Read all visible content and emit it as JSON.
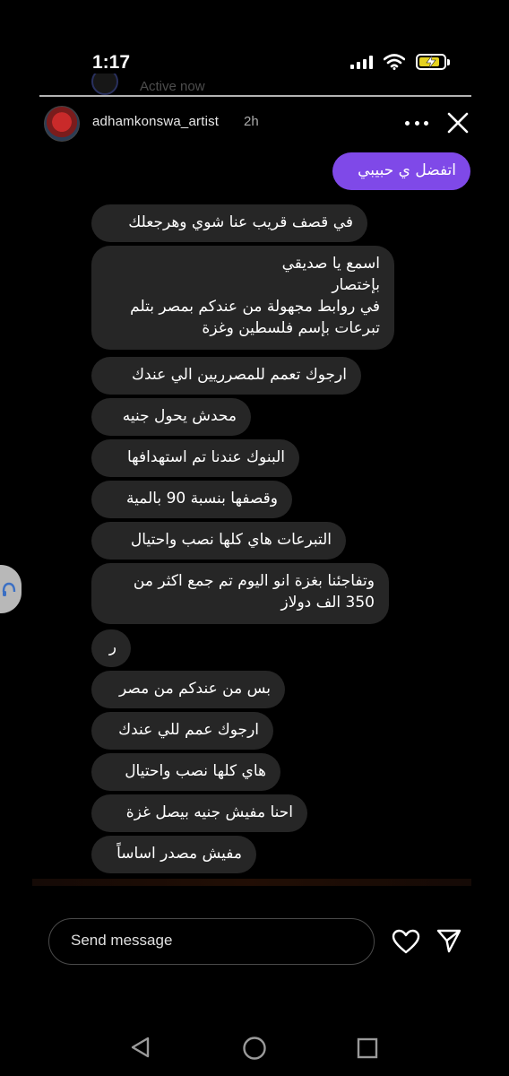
{
  "status_bar": {
    "time": "1:17",
    "battery_color": "#e5d220"
  },
  "overlap": {
    "text": "Active now"
  },
  "header": {
    "username": "adhamkonswa_artist",
    "time_ago": "2h",
    "icons": [
      "more-icon",
      "close-icon"
    ]
  },
  "messages": [
    {
      "sender": "me",
      "text": "اتفضل ي حبيبي"
    },
    {
      "sender": "them",
      "text": "في قصف قريب عنا شوي وهرجعلك"
    },
    {
      "sender": "them",
      "text": "اسمع يا صديقي\nبإختصار\nفي روابط مجهولة من عندكم بمصر بتلم\nتبرعات بإسم فلسطين وغزة"
    },
    {
      "sender": "them",
      "text": "ارجوك تعمم للمصرريين الي عندك"
    },
    {
      "sender": "them",
      "text": "محدش يحول جنيه"
    },
    {
      "sender": "them",
      "text": "البنوك عندنا تم استهدافها"
    },
    {
      "sender": "them",
      "text": "وقصفها بنسبة 90 بالمية"
    },
    {
      "sender": "them",
      "text": "التبرعات هاي كلها نصب واحتيال"
    },
    {
      "sender": "them",
      "text": "وتفاجئنا بغزة انو اليوم تم جمع اكثر من\n350 الف دولاز"
    },
    {
      "sender": "them",
      "text": "ر"
    },
    {
      "sender": "them",
      "text": "بس من عندكم من مصر"
    },
    {
      "sender": "them",
      "text": "ارجوك عمم للي عندك"
    },
    {
      "sender": "them",
      "text": "هاي كلها نصب واحتيال"
    },
    {
      "sender": "them",
      "text": "احنا مفيش جنيه بيصل غزة"
    },
    {
      "sender": "them",
      "text": "مفيش مصدر اساساً"
    }
  ],
  "composer": {
    "placeholder": "Send message",
    "icons": [
      "heart-icon",
      "send-icon"
    ]
  },
  "colors": {
    "outgoing_bubble": "#7f49e8",
    "incoming_bubble": "#262626",
    "background": "#000000"
  },
  "navbar": {
    "icons": [
      "back-icon",
      "home-icon",
      "recent-apps-icon"
    ]
  }
}
